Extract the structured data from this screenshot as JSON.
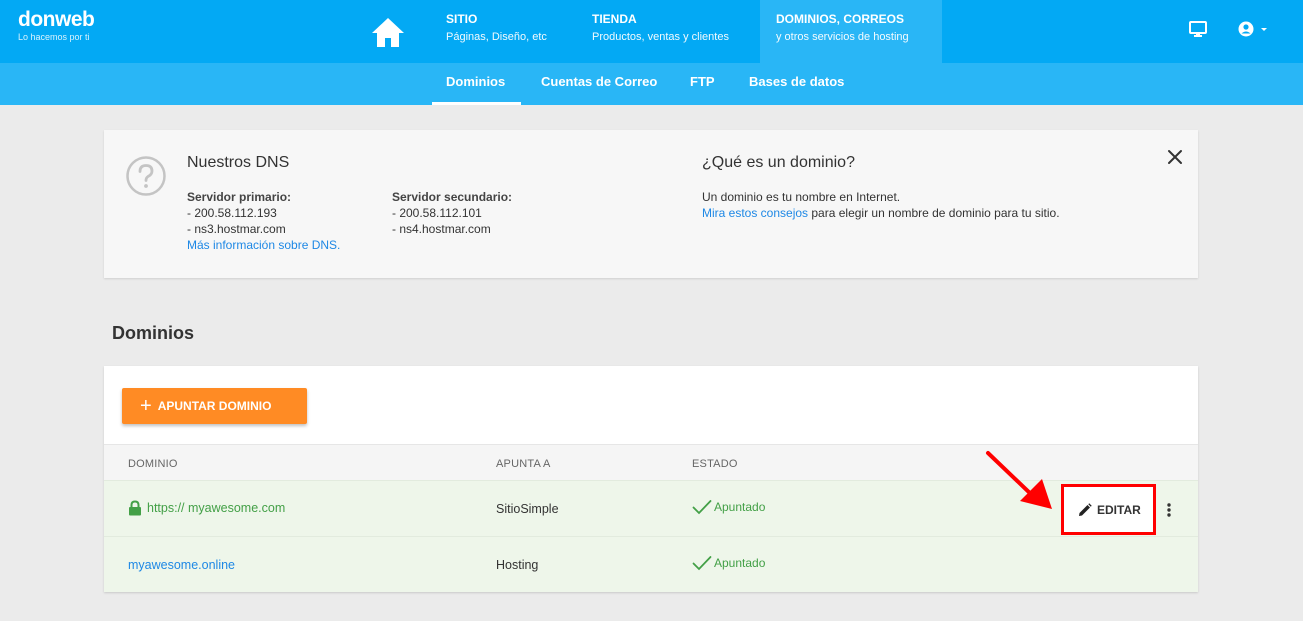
{
  "brand": {
    "name": "donweb",
    "tagline": "Lo hacemos por ti"
  },
  "topnav": [
    {
      "title": "SITIO",
      "subtitle": "Páginas, Diseño, etc"
    },
    {
      "title": "TIENDA",
      "subtitle": "Productos, ventas y clientes"
    },
    {
      "title": "DOMINIOS, CORREOS",
      "subtitle": "y otros servicios de hosting"
    }
  ],
  "subnav": [
    "Dominios",
    "Cuentas de Correo",
    "FTP",
    "Bases de datos"
  ],
  "dns": {
    "title": "Nuestros DNS",
    "primary_label": "Servidor primario:",
    "primary_ip": "- 200.58.112.193",
    "primary_host": "- ns3.hostmar.com",
    "more_link": "Más información sobre DNS.",
    "secondary_label": "Servidor secundario:",
    "secondary_ip": "- 200.58.112.101",
    "secondary_host": "- ns4.hostmar.com",
    "que_title": "¿Qué es un dominio?",
    "que_line1": "Un dominio es tu nombre en Internet.",
    "que_link": "Mira estos consejos",
    "que_line2_rest": " para elegir un nombre de dominio para tu sitio."
  },
  "section_title": "Dominios",
  "add_button": "APUNTAR DOMINIO",
  "table": {
    "headers": [
      "DOMINIO",
      "APUNTA A",
      "ESTADO"
    ],
    "rows": [
      {
        "domain": "https:// myawesome.com",
        "points_to": "SitioSimple",
        "status": "Apuntado"
      },
      {
        "domain": "myawesome.online",
        "points_to": "Hosting",
        "status": "Apuntado"
      }
    ]
  },
  "edit_button": "EDITAR",
  "colors": {
    "primary": "#03a9f4",
    "subnav": "#29b6f6",
    "accent": "#ff8b24",
    "success": "#43a047",
    "highlight": "#ff0000"
  }
}
